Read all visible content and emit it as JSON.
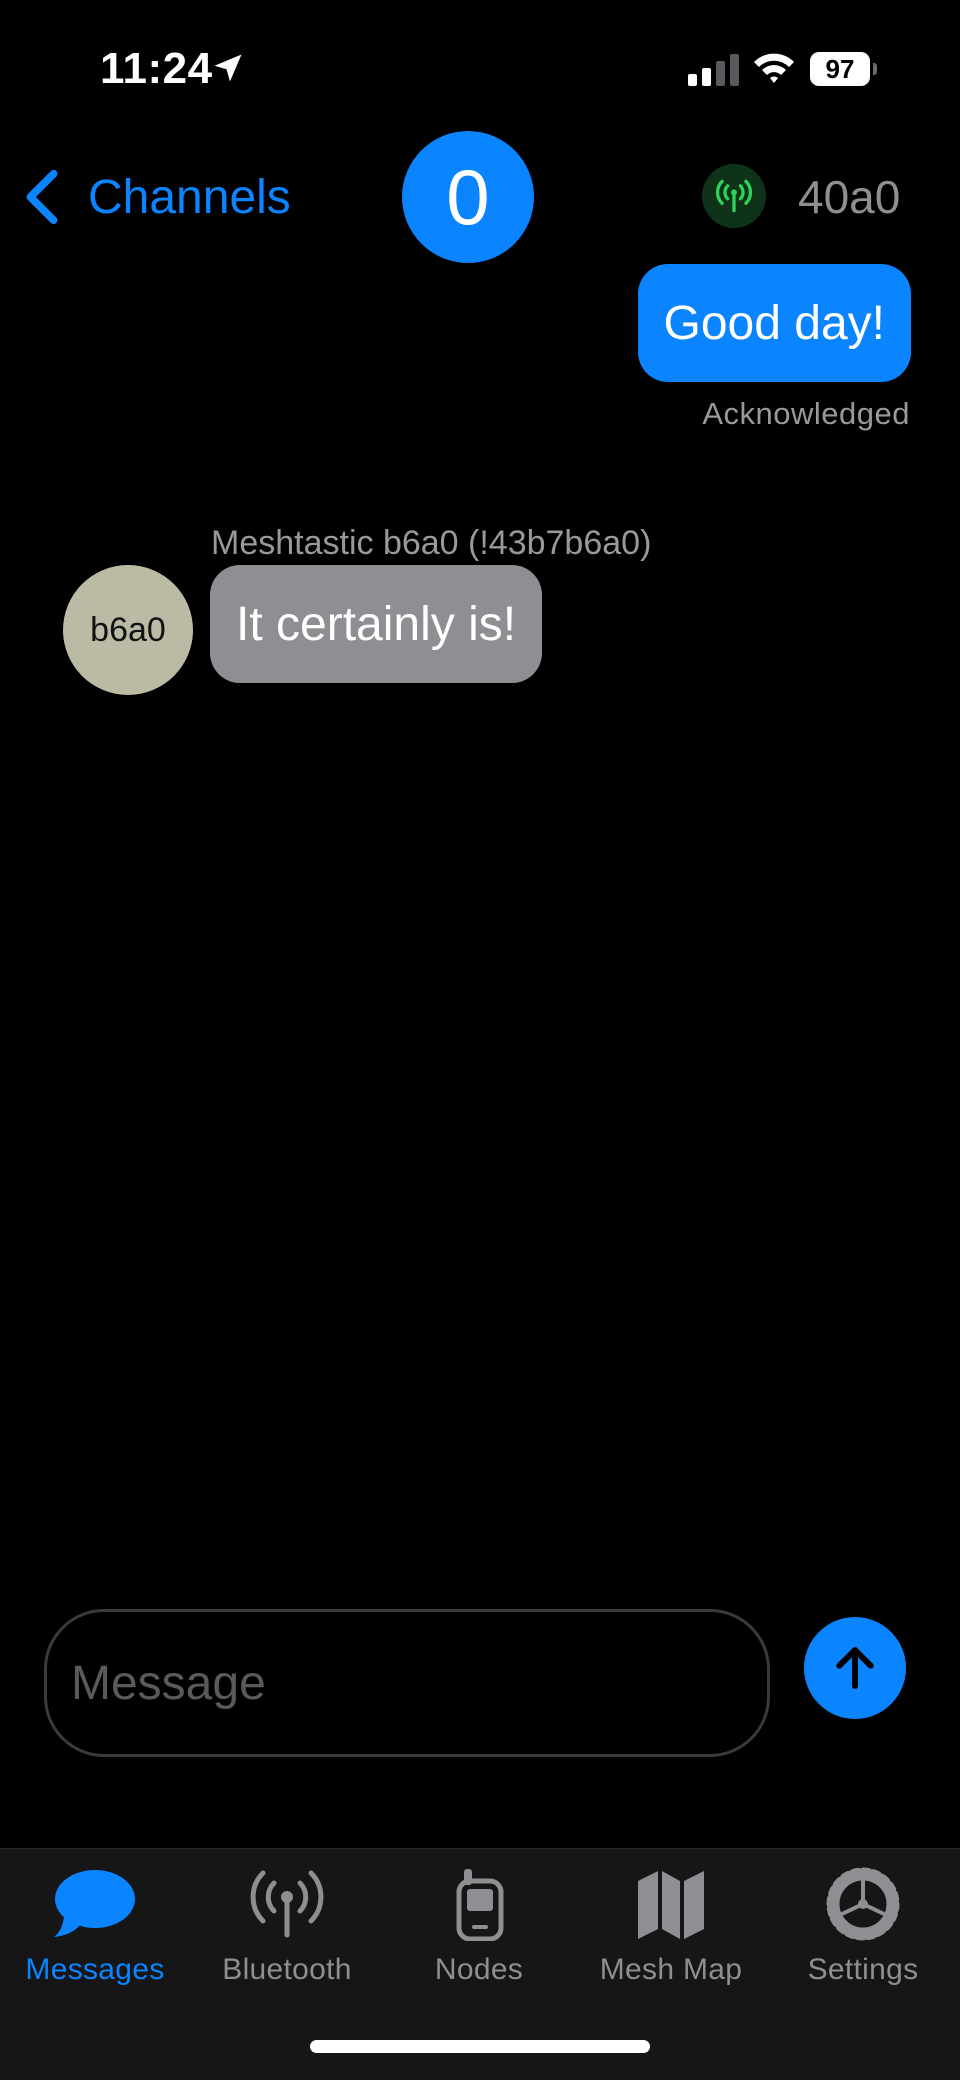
{
  "status_bar": {
    "time": "11:24",
    "battery": "97",
    "icons": [
      "location-arrow-icon",
      "cellular-signal-icon",
      "wifi-icon",
      "battery-icon"
    ]
  },
  "nav": {
    "back_label": "Channels",
    "channel_number": "0",
    "node_short_name": "40a0",
    "node_icon": "antenna-icon",
    "node_status_color": "#30d158"
  },
  "messages": [
    {
      "direction": "outgoing",
      "text": "Good day!",
      "status": "Acknowledged"
    },
    {
      "direction": "incoming",
      "sender": "Meshtastic b6a0 (!43b7b6a0)",
      "avatar": "b6a0",
      "text": "It certainly is!"
    }
  ],
  "composer": {
    "placeholder": "Message",
    "send_icon": "arrow-up-icon"
  },
  "tabs": [
    {
      "label": "Messages",
      "icon": "message-bubble-icon",
      "active": true
    },
    {
      "label": "Bluetooth",
      "icon": "antenna-icon",
      "active": false
    },
    {
      "label": "Nodes",
      "icon": "flip-phone-icon",
      "active": false
    },
    {
      "label": "Mesh Map",
      "icon": "map-icon",
      "active": false
    },
    {
      "label": "Settings",
      "icon": "gear-icon",
      "active": false
    }
  ],
  "colors": {
    "accent": "#0a84ff",
    "incoming_bubble": "#8e8e93",
    "avatar": "#bbbba5",
    "background": "#000000"
  }
}
